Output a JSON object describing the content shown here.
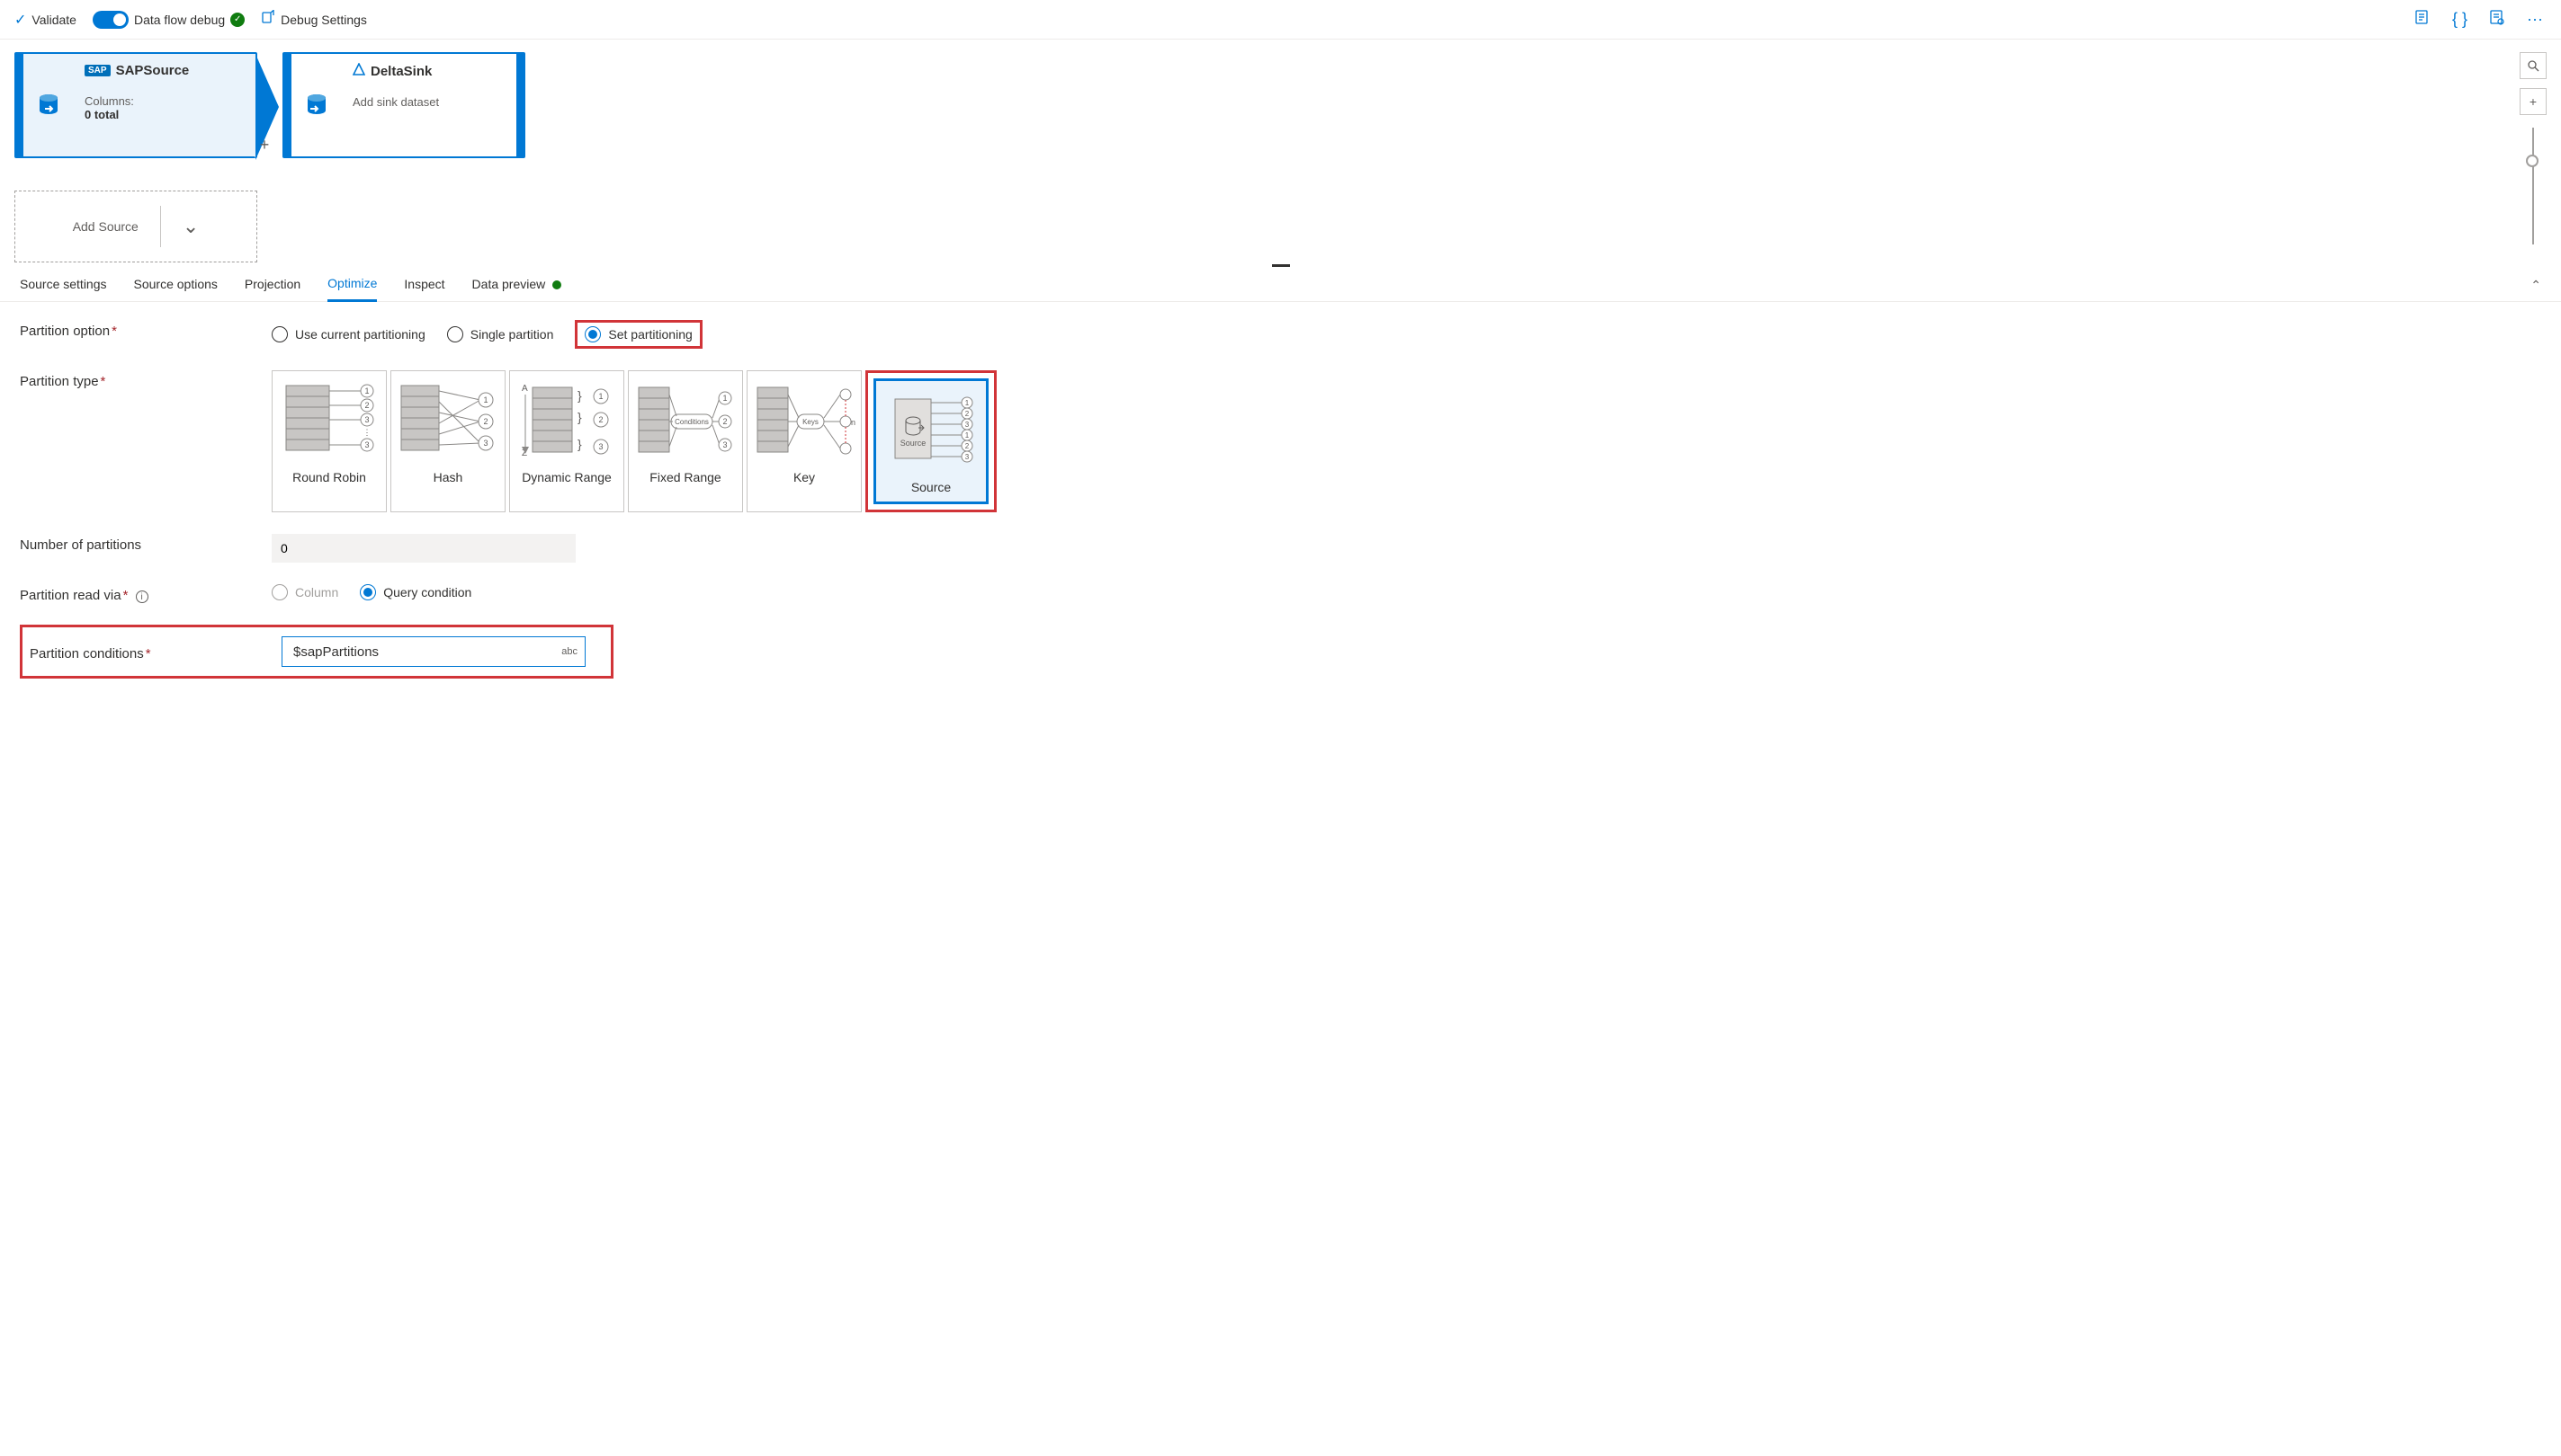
{
  "toolbar": {
    "validate": "Validate",
    "dataflow_debug": "Data flow debug",
    "debug_settings": "Debug Settings"
  },
  "canvas": {
    "source_node": {
      "badge": "SAP",
      "title": "SAPSource",
      "columns_label": "Columns:",
      "columns_value": "0 total"
    },
    "sink_node": {
      "title": "DeltaSink",
      "subtitle": "Add sink dataset"
    },
    "add_source": "Add Source"
  },
  "tabs": {
    "source_settings": "Source settings",
    "source_options": "Source options",
    "projection": "Projection",
    "optimize": "Optimize",
    "inspect": "Inspect",
    "data_preview": "Data preview"
  },
  "form": {
    "partition_option_label": "Partition option",
    "partition_option_radios": {
      "current": "Use current partitioning",
      "single": "Single partition",
      "set": "Set partitioning"
    },
    "partition_type_label": "Partition type",
    "partition_types": {
      "round_robin": "Round Robin",
      "hash": "Hash",
      "dynamic_range": "Dynamic Range",
      "fixed_range": "Fixed Range",
      "key": "Key",
      "source": "Source",
      "source_box_label": "Source"
    },
    "num_partitions_label": "Number of partitions",
    "num_partitions_value": "0",
    "partition_read_via_label": "Partition read via",
    "partition_read_via_radios": {
      "column": "Column",
      "query": "Query condition"
    },
    "partition_conditions_label": "Partition conditions",
    "partition_conditions_value": "$sapPartitions",
    "abc": "abc"
  }
}
